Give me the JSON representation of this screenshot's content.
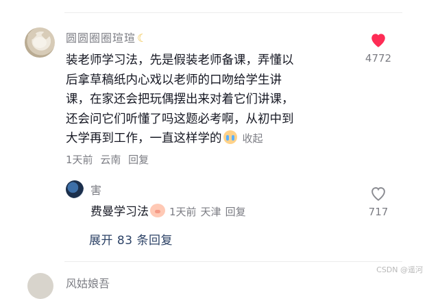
{
  "comment": {
    "username": "圆圆圈圈瑄瑄",
    "moon_icon": "crescent-moon-emoji",
    "lines": [
      "装老师学习法，先是假装老师备课，弄懂以",
      "后拿草稿纸内心戏以老师的口吻给学生讲",
      "课，在家还会把玩偶摆出来对着它们讲课，",
      "还会问它们听懂了吗这题必考啊，从初中到",
      "大学再到工作，一直这样学的"
    ],
    "collapse_label": "收起",
    "time": "1天前",
    "location": "云南",
    "reply_label": "回复",
    "like_count": "4772",
    "liked": true,
    "liked_color": "#fe2c55"
  },
  "reply": {
    "username": "害",
    "text": "费曼学习法",
    "time": "1天前",
    "location": "天津",
    "reply_label": "回复",
    "like_count": "717",
    "liked": false
  },
  "expand_label": "展开 83 条回复",
  "watermark": "CSDN @遥河",
  "next_comment": {
    "username": "风姑娘吾"
  }
}
